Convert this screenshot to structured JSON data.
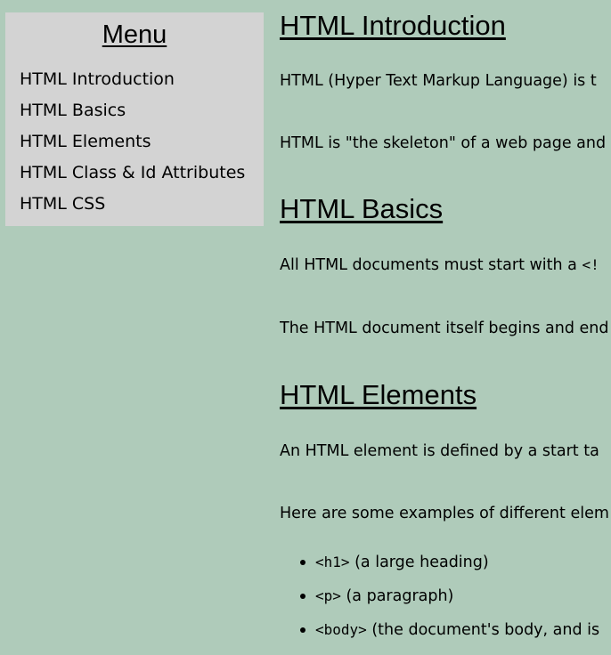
{
  "sidebar": {
    "title": "Menu",
    "items": [
      {
        "label": "HTML Introduction"
      },
      {
        "label": "HTML Basics"
      },
      {
        "label": "HTML Elements"
      },
      {
        "label": "HTML Class & Id Attributes"
      },
      {
        "label": "HTML CSS"
      }
    ]
  },
  "sections": [
    {
      "heading": "HTML Introduction",
      "paragraphs": [
        "HTML (Hyper Text Markup Language) is t",
        "HTML is \"the skeleton\" of a web page and"
      ]
    },
    {
      "heading": "HTML Basics",
      "paragraphs": [
        {
          "before": "All HTML documents must start with a ",
          "code": "<!"
        },
        "The HTML document itself begins and end"
      ]
    },
    {
      "heading": "HTML Elements",
      "paragraphs": [
        "An HTML element is defined by a start ta",
        "Here are some examples of different elem"
      ],
      "bullets": [
        {
          "code": "<h1>",
          "text": " (a large heading)"
        },
        {
          "code": "<p>",
          "text": " (a paragraph)"
        },
        {
          "code": "<body>",
          "text": " (the document's body, and is"
        }
      ]
    }
  ],
  "colors": {
    "page_background": "#afcbba",
    "sidebar_background": "#d3d3d3",
    "text": "#000000"
  }
}
